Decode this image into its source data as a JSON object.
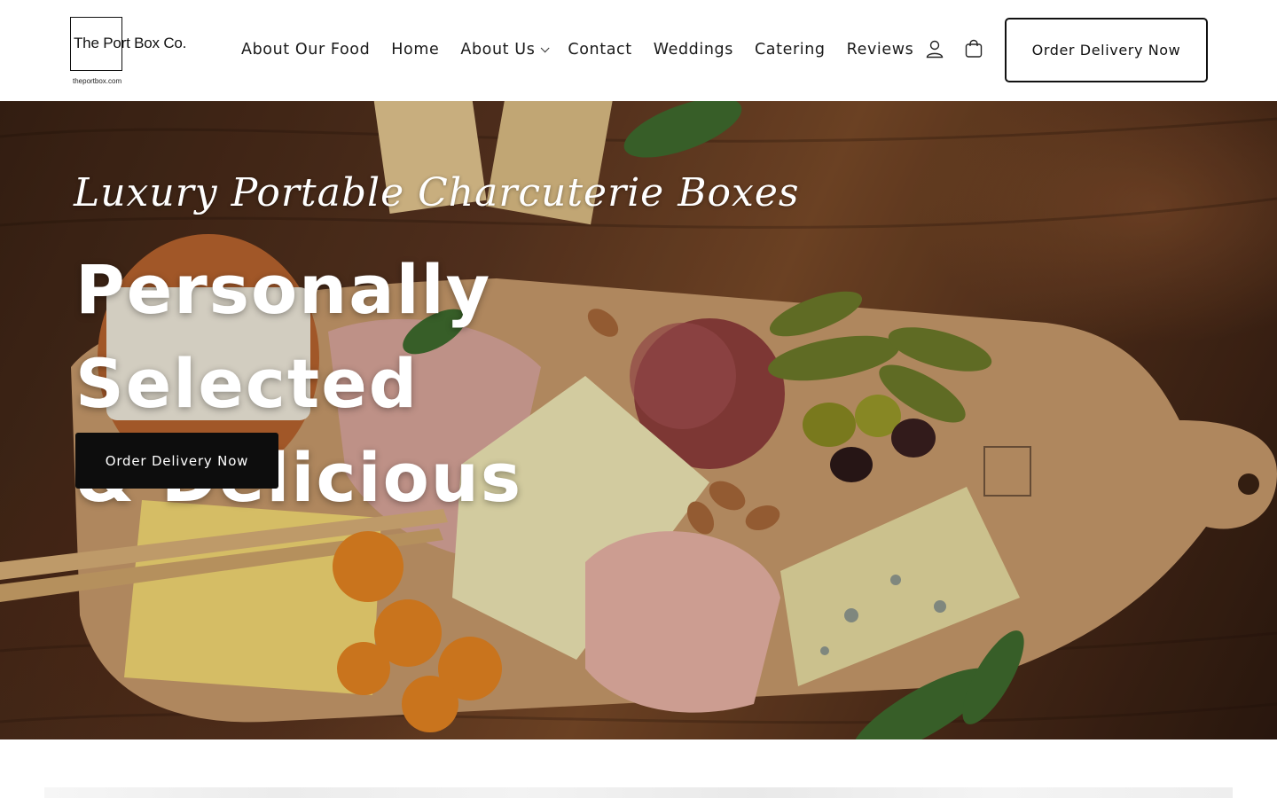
{
  "header": {
    "logo": {
      "name": "The Port Box Co.",
      "url": "theportbox.com"
    },
    "nav": [
      {
        "label": "About Our Food"
      },
      {
        "label": "Home"
      },
      {
        "label": "About Us",
        "has_dropdown": true
      },
      {
        "label": "Contact"
      },
      {
        "label": "Weddings"
      },
      {
        "label": "Catering"
      },
      {
        "label": "Reviews"
      }
    ],
    "icons": {
      "account": "user-icon",
      "cart": "shopping-bag-icon"
    },
    "cta_label": "Order Delivery Now"
  },
  "hero": {
    "subtitle": "Luxury Portable Charcuterie Boxes",
    "title_line1": "Personally Selected",
    "title_line2": "& Delicious",
    "cta_label": "Order Delivery Now"
  },
  "colors": {
    "text": "#121212",
    "button_dark": "#0d0d0d",
    "background": "#ffffff",
    "hero_wood": "#5a3520"
  }
}
